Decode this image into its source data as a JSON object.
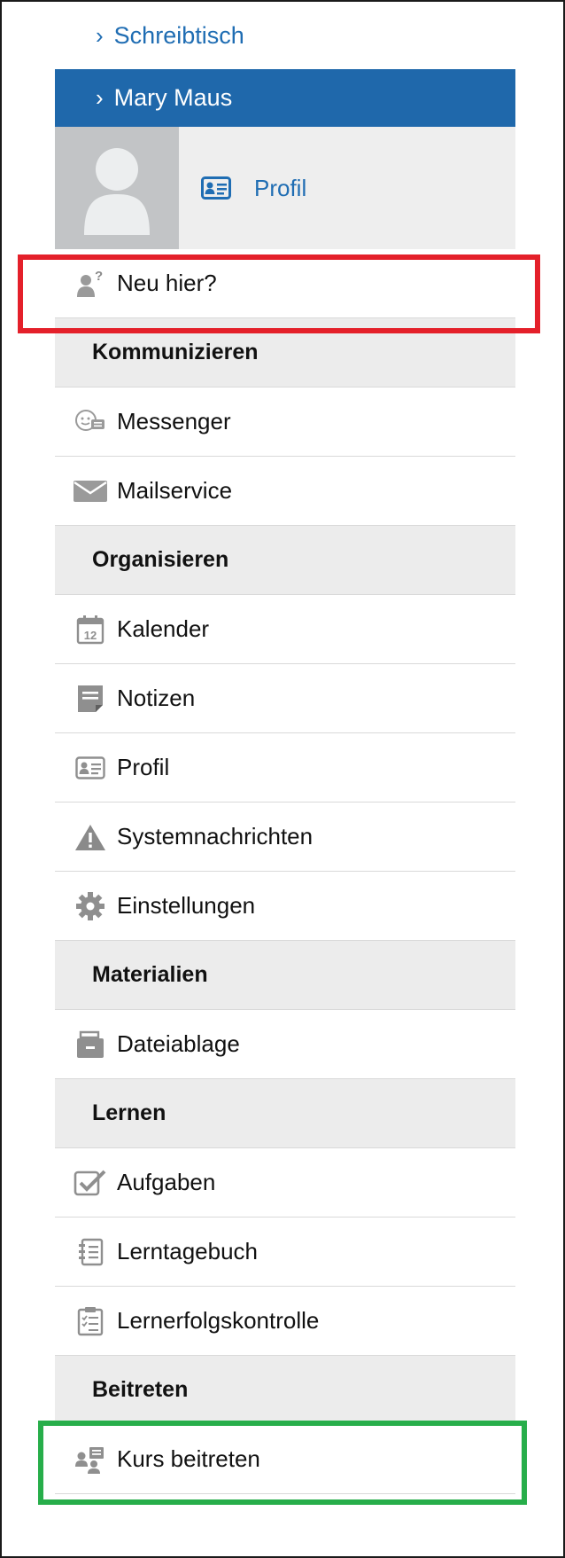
{
  "nav": {
    "breadcrumb_desk": "Schreibtisch",
    "breadcrumb_user": "Mary Maus",
    "profile_link": "Profil"
  },
  "menu": {
    "new_here": "Neu hier?",
    "sections": {
      "communicate": "Kommunizieren",
      "organize": "Organisieren",
      "materials": "Materialien",
      "learn": "Lernen",
      "join": "Beitreten"
    },
    "items": {
      "messenger": "Messenger",
      "mailservice": "Mailservice",
      "calendar": "Kalender",
      "notes": "Notizen",
      "profile": "Profil",
      "system_messages": "Systemnachrichten",
      "settings": "Einstellungen",
      "file_storage": "Dateiablage",
      "tasks": "Aufgaben",
      "learning_diary": "Lerntagebuch",
      "progress_check": "Lernerfolgskontrolle",
      "join_course": "Kurs beitreten"
    }
  },
  "icons": {
    "new_here": "user-question-icon",
    "messenger": "chat-bubble-icon",
    "mailservice": "envelope-icon",
    "calendar": "calendar-icon",
    "notes": "note-icon",
    "profile": "id-card-icon",
    "system_messages": "warning-icon",
    "settings": "gear-icon",
    "file_storage": "file-cabinet-icon",
    "tasks": "checkbox-icon",
    "learning_diary": "notebook-icon",
    "progress_check": "clipboard-icon",
    "join_course": "user-board-icon"
  },
  "colors": {
    "link": "#1f6db3",
    "active_bg": "#1f68ab",
    "highlight_red": "#e4202a",
    "highlight_green": "#27ae4a"
  }
}
